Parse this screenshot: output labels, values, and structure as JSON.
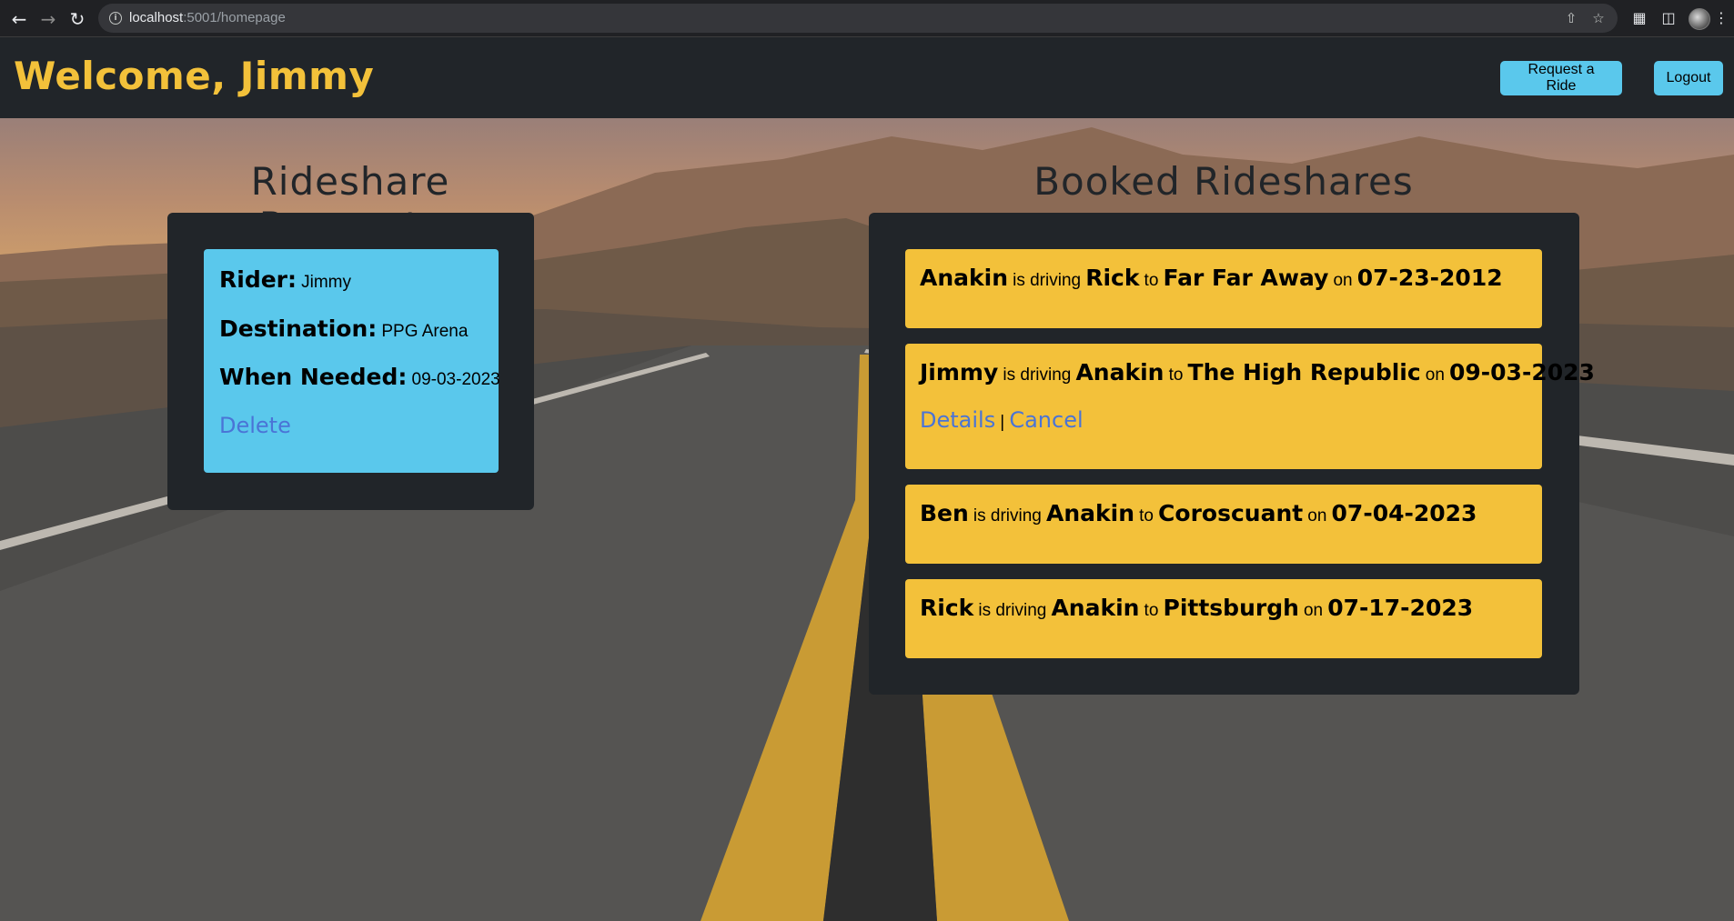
{
  "browser": {
    "url_host": "localhost",
    "url_path": ":5001/homepage"
  },
  "navbar": {
    "welcome": "Welcome, Jimmy",
    "request_ride_label": "Request a Ride",
    "logout_label": "Logout"
  },
  "requests": {
    "title": "Rideshare Requests",
    "items": [
      {
        "rider_label": "Rider:",
        "rider": "Jimmy",
        "destination_label": "Destination:",
        "destination": "PPG Arena",
        "when_label": "When Needed:",
        "when": "09-03-2023",
        "delete_label": "Delete"
      }
    ]
  },
  "booked": {
    "title": "Booked Rideshares",
    "connector_driving": "is driving",
    "connector_to": "to",
    "connector_on": "on",
    "details_label": "Details",
    "separator": "|",
    "cancel_label": "Cancel",
    "items": [
      {
        "driver": "Anakin",
        "rider": "Rick",
        "destination": "Far Far Away",
        "date": "07-23-2012"
      },
      {
        "driver": "Jimmy",
        "rider": "Anakin",
        "destination": "The High Republic",
        "date": "09-03-2023"
      },
      {
        "driver": "Ben",
        "rider": "Anakin",
        "destination": "Coroscuant",
        "date": "07-04-2023"
      },
      {
        "driver": "Rick",
        "rider": "Anakin",
        "destination": "Pittsburgh",
        "date": "07-17-2023"
      }
    ]
  },
  "colors": {
    "brand_yellow": "#f3c13a",
    "info_blue": "#5ac8ec",
    "dark": "#212529",
    "link_blue": "#4a74d6"
  }
}
